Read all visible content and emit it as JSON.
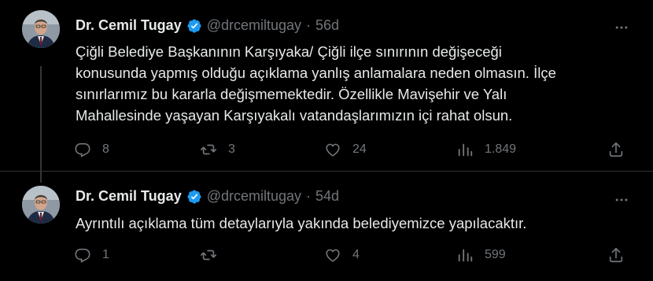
{
  "tweets": [
    {
      "author_name": "Dr. Cemil Tugay",
      "handle": "@drcemiltugay",
      "separator": "·",
      "time": "56d",
      "text": "Çiğli Belediye Başkanının Karşıyaka/ Çiğli ilçe sınırının değişeceği\nkonusunda yapmış olduğu açıklama yanlış anlamalara neden olmasın. İlçe\nsınırlarımız bu kararla değişmemektedir. Özellikle Mavişehir ve Yalı\nMahallesinde yaşayan Karşıyakalı vatandaşlarımızın içi rahat olsun.",
      "replies": "8",
      "retweets": "3",
      "likes": "24",
      "views": "1.849"
    },
    {
      "author_name": "Dr. Cemil Tugay",
      "handle": "@drcemiltugay",
      "separator": "·",
      "time": "54d",
      "text": "Ayrıntılı açıklama tüm detaylarıyla yakında belediyemizce yapılacaktır.",
      "replies": "1",
      "retweets": "",
      "likes": "4",
      "views": "599"
    }
  ],
  "icons": {
    "verified": "verified-badge-icon",
    "more": "more-icon",
    "reply": "reply-icon",
    "retweet": "retweet-icon",
    "like": "like-icon",
    "views": "views-icon",
    "share": "share-icon"
  },
  "colors": {
    "background": "#000000",
    "text": "#e7e9ea",
    "secondary": "#71767b",
    "verified": "#1d9bf0",
    "divider": "#2f3336"
  }
}
